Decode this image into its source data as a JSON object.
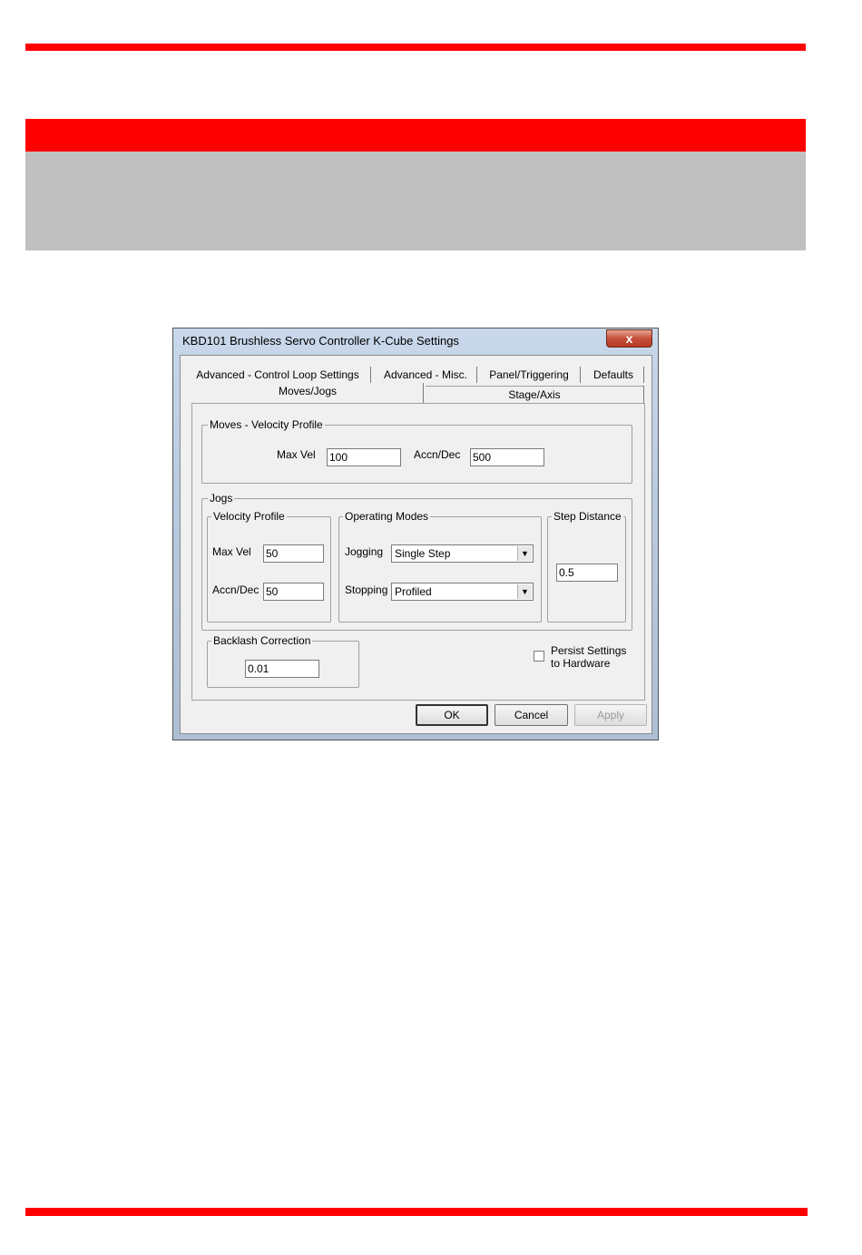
{
  "dialog": {
    "title": "KBD101 Brushless Servo Controller K-Cube Settings",
    "close_glyph": "x"
  },
  "tabs": {
    "row1": [
      "Advanced - Control Loop Settings",
      "Advanced - Misc.",
      "Panel/Triggering",
      "Defaults"
    ],
    "row2": [
      "Moves/Jogs",
      "Stage/Axis"
    ],
    "active": "Moves/Jogs"
  },
  "moves": {
    "legend": "Moves - Velocity Profile",
    "max_vel_label": "Max Vel",
    "max_vel_value": "100",
    "accn_label": "Accn/Dec",
    "accn_value": "500"
  },
  "jogs": {
    "legend": "Jogs",
    "velocity_profile": {
      "legend": "Velocity Profile",
      "max_vel_label": "Max Vel",
      "max_vel_value": "50",
      "accn_label": "Accn/Dec",
      "accn_value": "50"
    },
    "operating_modes": {
      "legend": "Operating Modes",
      "jogging_label": "Jogging",
      "jogging_value": "Single Step",
      "stopping_label": "Stopping",
      "stopping_value": "Profiled"
    },
    "step_distance": {
      "legend": "Step Distance",
      "value": "0.5"
    }
  },
  "backlash": {
    "legend": "Backlash Correction",
    "value": "0.01"
  },
  "persist": {
    "line1": "Persist Settings",
    "line2": "to Hardware",
    "checked": false
  },
  "buttons": {
    "ok": "OK",
    "cancel": "Cancel",
    "apply": "Apply"
  },
  "icons": {
    "dropdown": "▼"
  },
  "colors": {
    "brand_red": "#ff0000",
    "header_grey": "#c0c0c0",
    "dialog_face": "#f0f0f0"
  }
}
